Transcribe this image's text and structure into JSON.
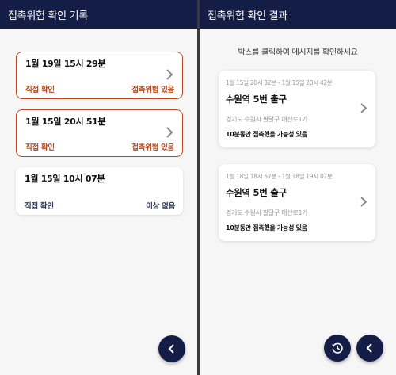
{
  "left_screen": {
    "title": "접촉위험 확인 기록",
    "records": [
      {
        "time": "1월 19일 15시 29분",
        "type": "직접 확인",
        "status": "접촉위험 있음",
        "risk": true
      },
      {
        "time": "1월 15일 20시 51분",
        "type": "직접 확인",
        "status": "접촉위험 있음",
        "risk": true
      },
      {
        "time": "1월 15일 10시 07분",
        "type": "직접 확인",
        "status": "이상 없음",
        "risk": false
      }
    ],
    "back_icon": "chevron-left-icon"
  },
  "right_screen": {
    "title": "접촉위험 확인 결과",
    "hint": "박스를 클릭하여 메시지를 확인하세요",
    "results": [
      {
        "period": "1월 15일 20시 32분 - 1월 15일 20시 42분",
        "place": "수원역 5번 출구",
        "address": "경기도 수원시 팔달구 매산로1가",
        "description": "10분동안 접촉했을 가능성 있음"
      },
      {
        "period": "1월 18일 18시 57분 - 1월 18일 19시 07분",
        "place": "수원역 5번 출구",
        "address": "경기도 수원시 팔달구 매산로1가",
        "description": "10분동안 접촉했을 가능성 있음"
      }
    ],
    "history_icon": "history-icon",
    "back_icon": "chevron-left-icon"
  },
  "colors": {
    "appbar": "#141d45",
    "danger": "#b8491f",
    "safe": "#2f3b5e",
    "background": "#f6f6f6"
  }
}
